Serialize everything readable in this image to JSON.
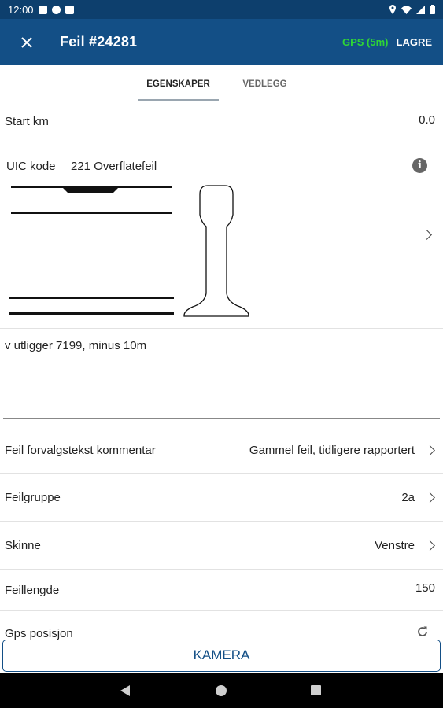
{
  "status_bar": {
    "time": "12:00"
  },
  "app_bar": {
    "title": "Feil #24281",
    "gps": "GPS (5m)",
    "save": "LAGRE"
  },
  "tabs": [
    {
      "label": "EGENSKAPER",
      "active": true
    },
    {
      "label": "VEDLEGG",
      "active": false
    }
  ],
  "start_km": {
    "label": "Start km",
    "value": "0.0"
  },
  "uic": {
    "label": "UIC kode",
    "value": "221 Overflatefeil"
  },
  "comment": "v utligger 7199, minus 10m",
  "fields": {
    "kommentar": {
      "label": "Feil forvalgstekst kommentar",
      "value": "Gammel feil, tidligere rapportert"
    },
    "feilgruppe": {
      "label": "Feilgruppe",
      "value": "2a"
    },
    "skinne": {
      "label": "Skinne",
      "value": "Venstre"
    },
    "feillengde": {
      "label": "Feillengde",
      "value": "150"
    },
    "gps": {
      "label": "Gps posisjon"
    }
  },
  "camera_button": "KAMERA",
  "colors": {
    "app_bar": "#134f86",
    "status_bar": "#0d3f6d",
    "gps": "#2fd635",
    "accent": "#134f86"
  }
}
